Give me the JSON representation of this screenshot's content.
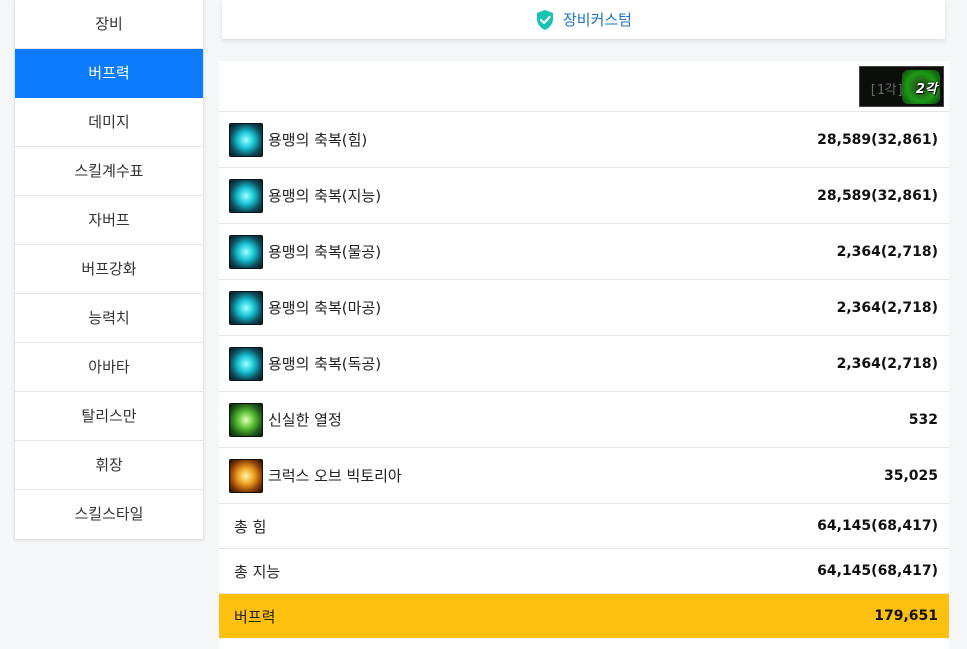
{
  "sidebar": {
    "items": [
      {
        "label": "장비",
        "active": false
      },
      {
        "label": "버프력",
        "active": true
      },
      {
        "label": "데미지",
        "active": false
      },
      {
        "label": "스킬계수표",
        "active": false
      },
      {
        "label": "자버프",
        "active": false
      },
      {
        "label": "버프강화",
        "active": false
      },
      {
        "label": "능력치",
        "active": false
      },
      {
        "label": "아바타",
        "active": false
      },
      {
        "label": "탈리스만",
        "active": false
      },
      {
        "label": "휘장",
        "active": false
      },
      {
        "label": "스킬스타일",
        "active": false
      }
    ]
  },
  "custom_button": {
    "label": "장비커스텀",
    "icon": "shield-check-icon",
    "color": "#1a73c9"
  },
  "header": {
    "thumb_left": "[1각]",
    "thumb_right": "2각"
  },
  "buffs": [
    {
      "name": "용맹의 축복(힘)",
      "value": "28,589(32,861)",
      "icon": "sword-up-icon",
      "tone": "blue"
    },
    {
      "name": "용맹의 축복(지능)",
      "value": "28,589(32,861)",
      "icon": "sword-up-icon",
      "tone": "blue"
    },
    {
      "name": "용맹의 축복(물공)",
      "value": "2,364(2,718)",
      "icon": "crossed-swords-icon",
      "tone": "blue"
    },
    {
      "name": "용맹의 축복(마공)",
      "value": "2,364(2,718)",
      "icon": "wings-icon",
      "tone": "blue"
    },
    {
      "name": "용맹의 축복(독공)",
      "value": "2,364(2,718)",
      "icon": "triple-sword-icon",
      "tone": "blue"
    },
    {
      "name": "신실한 열정",
      "value": "532",
      "icon": "green-cross-icon",
      "tone": "green"
    },
    {
      "name": "크럭스 오브 빅토리아",
      "value": "35,025",
      "icon": "gold-cross-icon",
      "tone": "gold"
    }
  ],
  "totals": [
    {
      "name": "총 힘",
      "value": "64,145(68,417)"
    },
    {
      "name": "총 지능",
      "value": "64,145(68,417)"
    }
  ],
  "buff_power": {
    "name": "버프력",
    "value": "179,651",
    "color": "#fdc00f"
  }
}
